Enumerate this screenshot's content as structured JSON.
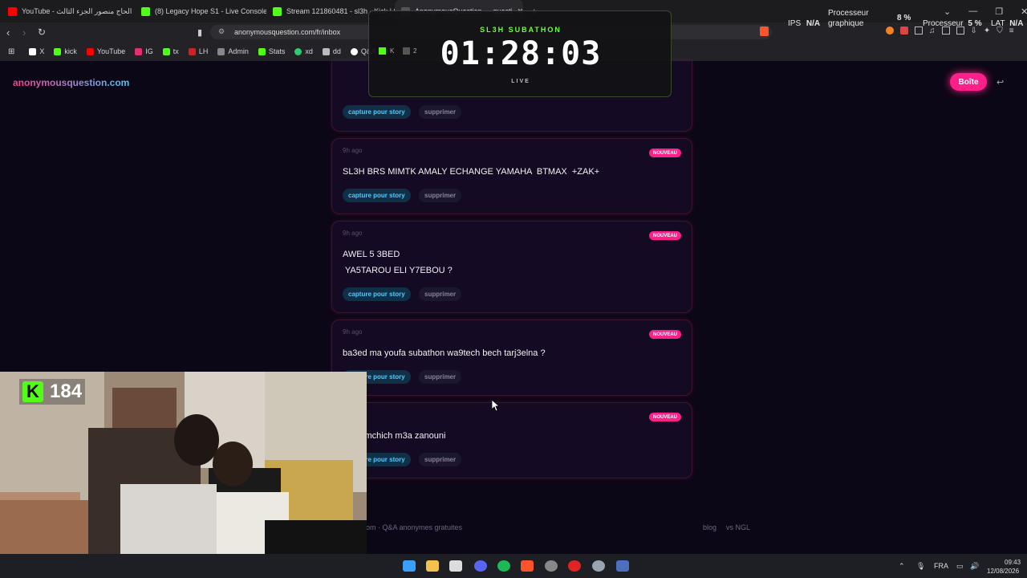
{
  "tabs": [
    {
      "title": "YouTube - الحاج منصور الجزء الثالث",
      "color": "#ff0000"
    },
    {
      "title": "(8) Legacy Hope S1 - Live Console",
      "color": "#53fc18"
    },
    {
      "title": "Stream 121860481 - sl3h - Kick | St",
      "color": "#53fc18"
    },
    {
      "title": "AnonymousQuestion — questi",
      "color": "#555555"
    }
  ],
  "new_tab": "+",
  "url": "anonymousquestion.com/fr/inbox",
  "bookmarks": [
    {
      "label": "X",
      "color": "#ffffff"
    },
    {
      "label": "kick",
      "color": "#53fc18"
    },
    {
      "label": "YouTube",
      "color": "#ff0000"
    },
    {
      "label": "IG",
      "color": "#e1306c"
    },
    {
      "label": "tx",
      "color": "#53fc18"
    },
    {
      "label": "LH",
      "color": "#cc2222"
    },
    {
      "label": "Admin",
      "color": "#888888"
    },
    {
      "label": "Stats",
      "color": "#53fc18"
    },
    {
      "label": "xd",
      "color": "#2ecc71"
    },
    {
      "label": "dd",
      "color": "#bbbbbb"
    },
    {
      "label": "Q&A",
      "color": "#ffffff"
    }
  ],
  "site": {
    "brand": "anonymousquestion.com",
    "inbox_button": "Boîte"
  },
  "overlay": {
    "title": "SL3H SUBATHON",
    "timer": "01:28:03",
    "status": "LIVE",
    "small_k": "K",
    "small_2": "2"
  },
  "hud": {
    "ips_label": "IPS",
    "ips_value": "N/A",
    "proc_label": "Processeur",
    "proc_sub": "graphique",
    "proc_value": "8 %",
    "proc2_label": "Processeur",
    "proc2_value": "5 %",
    "lat_label": "LAT",
    "lat_value": "N/A"
  },
  "cards": [
    {
      "ago": "",
      "badge": "",
      "message": "",
      "story": "capture pour story",
      "delete": "supprimer"
    },
    {
      "ago": "9h ago",
      "badge": "NOUVEAU",
      "message": "SL3H BRS MIMTK AMALY ECHANGE YAMAHA  BTMAX  +ZAK+",
      "story": "capture pour story",
      "delete": "supprimer"
    },
    {
      "ago": "9h ago",
      "badge": "NOUVEAU",
      "message": "AWEL 5 3BED\n YA5TAROU ELI Y7EBOU ?",
      "story": "capture pour story",
      "delete": "supprimer"
    },
    {
      "ago": "9h ago",
      "badge": "NOUVEAU",
      "message": "ba3ed ma youfa subathon wa9tech bech tarj3elna ?",
      "story": "capture pour story",
      "delete": "supprimer"
    },
    {
      "ago": "",
      "badge": "NOUVEAU",
      "message": "ma temchich m3a zanouni",
      "story": "capture pour story",
      "delete": "supprimer"
    }
  ],
  "footer": {
    "left": "n.com · Q&A anonymes gratuites",
    "blog": "blog",
    "vs": "vs NGL"
  },
  "webcam": {
    "viewer_logo": "K",
    "viewer_count": "184"
  },
  "taskbar": {
    "lang": "FRA",
    "time": "09:43",
    "date": "12/08/2026"
  },
  "colors": {
    "accent_pink": "#ff1f8a",
    "accent_blue": "#58c8ff",
    "kick_green": "#53fc18"
  }
}
